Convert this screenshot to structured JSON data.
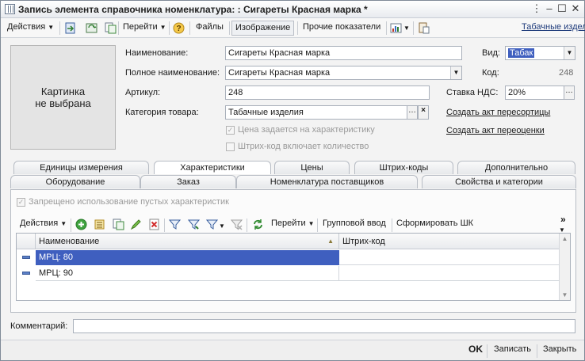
{
  "window": {
    "title": "Запись элемента справочника номенклатура: : Сигареты Красная марка *"
  },
  "toolbar": {
    "actions": "Действия",
    "goto": "Перейти",
    "files": "Файлы",
    "image": "Изображение",
    "other_indicators": "Прочие показатели",
    "group_link": "Табачные изделия"
  },
  "picture": {
    "text": "Картинка\nне выбрана"
  },
  "form": {
    "name_label": "Наименование:",
    "name_value": "Сигареты Красная марка",
    "full_name_label": "Полное наименование:",
    "full_name_value": "Сигареты Красная марка",
    "article_label": "Артикул:",
    "article_value": "248",
    "category_label": "Категория товара:",
    "category_value": "Табачные изделия",
    "price_by_characteristic": "Цена задается на характеристику",
    "barcode_includes_qty": "Штрих-код включает количество",
    "kind_label": "Вид:",
    "kind_value": "Табак",
    "code_label": "Код:",
    "code_value": "248",
    "vat_label": "Ставка НДС:",
    "vat_value": "20%",
    "regrading_act": "Создать акт пересортицы",
    "revaluation_act": "Создать акт переоценки"
  },
  "tabs_row1": [
    "Единицы измерения",
    "Характеристики",
    "Цены",
    "Штрих-коды",
    "Дополнительно"
  ],
  "tabs_row2": [
    "Оборудование",
    "Заказ",
    "Номенклатура поставщиков",
    "Свойства и категории"
  ],
  "panel": {
    "forbid_empty": "Запрещено использование пустых характеристик",
    "actions": "Действия",
    "goto": "Перейти",
    "group_input": "Групповой ввод",
    "generate_barcode": "Сформировать ШК",
    "more": "»"
  },
  "grid": {
    "columns": [
      "Наименование",
      "Штрих-код"
    ],
    "rows": [
      {
        "name": "МРЦ: 80",
        "barcode": "",
        "selected": true
      },
      {
        "name": "МРЦ: 90",
        "barcode": "",
        "selected": false
      }
    ]
  },
  "comment": {
    "label": "Комментарий:",
    "value": ""
  },
  "footer": {
    "ok": "OK",
    "save": "Записать",
    "close": "Закрыть"
  }
}
